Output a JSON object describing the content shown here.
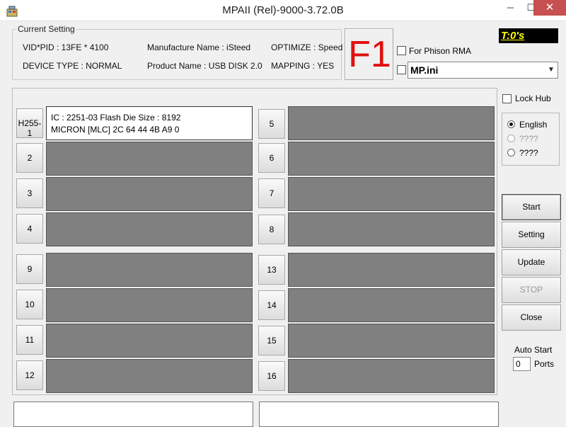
{
  "window": {
    "title": "MPAII (Rel)-9000-3.72.0B",
    "minimize_glyph": "─",
    "maximize_glyph": "☐",
    "close_glyph": "✕"
  },
  "current_setting": {
    "legend": "Current Setting",
    "vid_pid": "VID*PID : 13FE * 4100",
    "device_type": "DEVICE TYPE : NORMAL",
    "manufacture_name": "Manufacture Name : iSteed",
    "product_name": "Product Name : USB DISK 2.0",
    "optimize": "OPTIMIZE : Speed",
    "mapping": "MAPPING : YES"
  },
  "f1_label": "F1",
  "for_phison_rma": {
    "label": "For Phison RMA",
    "checked": false
  },
  "ini_select": {
    "checked": false,
    "value": "MP.ini"
  },
  "timer": "T:0's",
  "ports": [
    {
      "label": "H255-1",
      "active": true,
      "line1": "IC : 2251-03  Flash Die Size : 8192",
      "line2": "MICRON [MLC] 2C 64 44 4B A9 0"
    },
    {
      "label": "2"
    },
    {
      "label": "3"
    },
    {
      "label": "4"
    },
    {
      "label": "5"
    },
    {
      "label": "6"
    },
    {
      "label": "7"
    },
    {
      "label": "8"
    },
    {
      "label": "9"
    },
    {
      "label": "10"
    },
    {
      "label": "11"
    },
    {
      "label": "12"
    },
    {
      "label": "13"
    },
    {
      "label": "14"
    },
    {
      "label": "15"
    },
    {
      "label": "16"
    }
  ],
  "lock_hub": {
    "label": "Lock Hub",
    "checked": false
  },
  "language": {
    "options": [
      {
        "label": "English",
        "selected": true,
        "enabled": true
      },
      {
        "label": "????",
        "selected": false,
        "enabled": false
      },
      {
        "label": "????",
        "selected": false,
        "enabled": true
      }
    ]
  },
  "actions": {
    "start": "Start",
    "setting": "Setting",
    "update": "Update",
    "stop": "STOP",
    "close": "Close"
  },
  "auto_start": {
    "label": "Auto Start",
    "value": "0",
    "ports_label": "Ports"
  }
}
